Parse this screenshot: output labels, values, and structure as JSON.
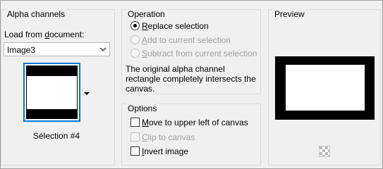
{
  "alpha_channels": {
    "title": "Alpha channels",
    "load_label_pre": "Load from ",
    "load_label_ul": "d",
    "load_label_post": "ocument:",
    "document_value": "Image3",
    "selection_caption": "Sélection #4"
  },
  "operation": {
    "title": "Operation",
    "replace": {
      "ul": "R",
      "rest": "eplace selection"
    },
    "add": {
      "ul": "A",
      "rest": "dd to current selection"
    },
    "subtract": {
      "ul": "S",
      "rest": "ubtract from current selection"
    },
    "selected": "replace",
    "info_line1": "The original alpha channel",
    "info_line2": "rectangle completely intersects the",
    "info_line3": "canvas."
  },
  "options": {
    "title": "Options",
    "move": {
      "ul": "M",
      "rest": "ove to upper left of canvas",
      "checked": false,
      "enabled": true
    },
    "clip": {
      "ul": "C",
      "rest": "lip to canvas",
      "checked": false,
      "enabled": false
    },
    "invert": {
      "ul": "I",
      "rest": "nvert image",
      "checked": false,
      "enabled": true
    }
  },
  "preview": {
    "title": "Preview"
  }
}
